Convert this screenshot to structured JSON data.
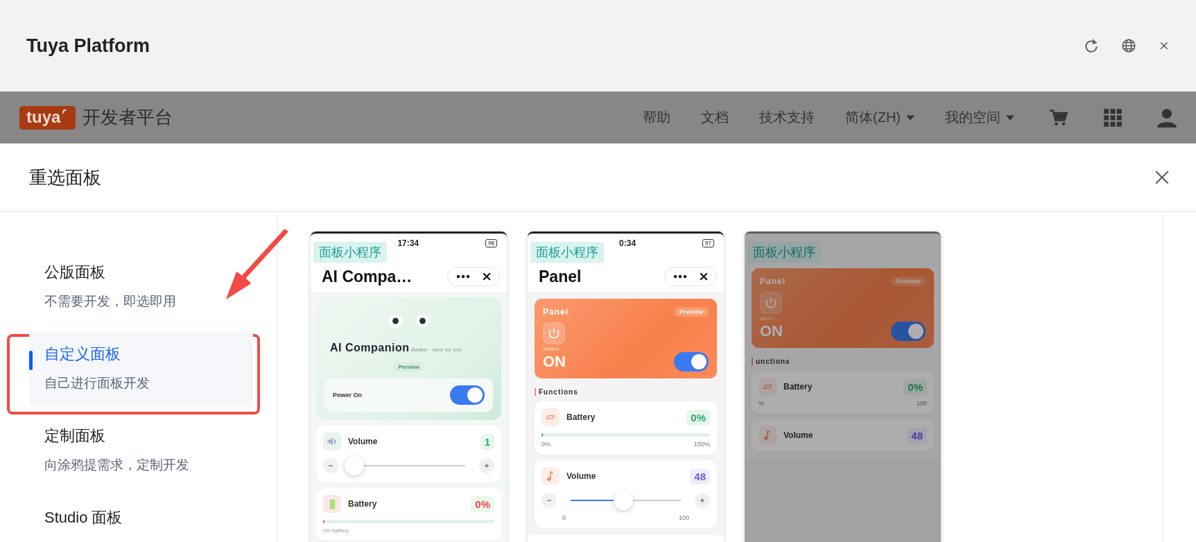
{
  "window": {
    "title": "Tuya Platform"
  },
  "navbar": {
    "logo_text": "tuya",
    "brand": "开发者平台",
    "links": [
      {
        "label": "帮助",
        "dropdown": false
      },
      {
        "label": "文档",
        "dropdown": false
      },
      {
        "label": "技术支持",
        "dropdown": false
      },
      {
        "label": "简体(ZH)",
        "dropdown": true
      },
      {
        "label": "我的空间",
        "dropdown": true
      }
    ]
  },
  "dialog": {
    "title": "重选面板"
  },
  "sidebar": {
    "items": [
      {
        "title": "公版面板",
        "subtitle": "不需要开发，即选即用",
        "selected": false,
        "annotated": false
      },
      {
        "title": "自定义面板",
        "subtitle": "自己进行面板开发",
        "selected": true,
        "annotated": true
      },
      {
        "title": "定制面板",
        "subtitle": "向涂鸦提需求，定制开发",
        "selected": false,
        "annotated": false
      },
      {
        "title": "Studio 面板",
        "selected": false,
        "annotated": false
      }
    ]
  },
  "cards": [
    {
      "kind": "companion",
      "dimmed": false,
      "tag": "面板小程序",
      "time": "17:34",
      "battery": "98",
      "title": "AI Compa…",
      "hero_title": "AI Companion",
      "hero_status": "Awake · here for you",
      "badge": "Preview",
      "power_label": "Power On",
      "power_on": true,
      "volume": {
        "label": "Volume",
        "value": "1",
        "level": 0.02
      },
      "battery_row": {
        "label": "Battery",
        "value": "0%",
        "level": 0.01,
        "note": "On battery"
      }
    },
    {
      "kind": "panel",
      "dimmed": false,
      "tag": "面板小程序",
      "time": "0:34",
      "battery": "97",
      "title": "Panel",
      "hero_title": "Panel",
      "badge": "Preview",
      "switch_label": "Switch",
      "state_text": "ON",
      "power_on": true,
      "section": "Functions",
      "battery_row": {
        "label": "Battery",
        "value": "0%",
        "level": 0.01,
        "min": "0%",
        "max": "100%"
      },
      "volume": {
        "label": "Volume",
        "value": "48",
        "level": 0.48,
        "min": "0",
        "max": "100"
      }
    },
    {
      "kind": "panel",
      "dimmed": true,
      "tag": "面板小程序",
      "hero_title": "Panel",
      "badge": "Preview",
      "switch_label": "witch",
      "state_text": "ON",
      "power_on": true,
      "section": "unctions",
      "battery_row": {
        "label": "Battery",
        "value": "0%",
        "min": "%",
        "max": "100"
      },
      "volume": {
        "label": "Volume",
        "value": "48"
      }
    }
  ]
}
